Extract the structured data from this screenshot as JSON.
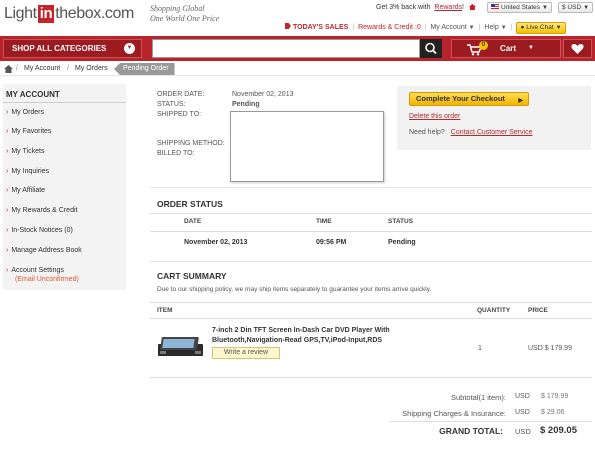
{
  "header": {
    "logo_left": "Light",
    "logo_in": "in",
    "logo_right": "thebox.com",
    "tagline_1": "Shopping Global",
    "tagline_2": "One World One Price",
    "cashback_text": "Get 3% back with",
    "rewards_link": "Rewards",
    "rewards_suffix": "!",
    "country": "United States",
    "currency": "$ USD",
    "todays_sales": "TODAY'S SALES",
    "rewards_credit": "Rewards & Credit :0",
    "my_account": "My Account",
    "help": "Help",
    "live_chat": "Live Chat"
  },
  "nav": {
    "all_categories": "SHOP ALL CATEGORIES",
    "search_value": "",
    "cart_label": "Cart",
    "cart_count": "0"
  },
  "breadcrumb": {
    "items": [
      "My Account",
      "My Orders"
    ],
    "current": "Pending Order"
  },
  "sidebar": {
    "title": "MY ACCOUNT",
    "items": [
      {
        "label": "My Orders"
      },
      {
        "label": "My Favorites"
      },
      {
        "label": "My Tickets"
      },
      {
        "label": "My Inquiries"
      },
      {
        "label": "My Affiliate"
      },
      {
        "label": "My Rewards & Credit"
      },
      {
        "label": "In-Stock Notices (0)"
      },
      {
        "label": "Manage Address Book"
      },
      {
        "label": "Account Settings"
      }
    ],
    "account_note": "(Email Unconfirmed)"
  },
  "order": {
    "date_label": "ORDER DATE:",
    "date_value": "November 02, 2013",
    "status_label": "STATUS:",
    "status_value": "Pending",
    "shipped_label": "SHIPPED TO:",
    "shipping_method_label": "SHIPPING METHOD:",
    "billed_label": "BILLED TO:",
    "complete_checkout": "Complete Your Checkout",
    "delete_order": "Delete this order",
    "need_help": "Need help?",
    "contact_support": "Contact Customer Service"
  },
  "order_status": {
    "title": "ORDER STATUS",
    "headers": [
      "DATE",
      "TIME",
      "STATUS"
    ],
    "rows": [
      {
        "date": "November 02, 2013",
        "time": "09:56 PM",
        "status": "Pending"
      }
    ]
  },
  "cart_summary": {
    "title": "CART SUMMARY",
    "note": "Due to our shipping policy, we may ship items separately to guarantee your items arrive quickly.",
    "headers": {
      "item": "ITEM",
      "quantity": "QUANTITY",
      "price": "PRICE"
    },
    "items": [
      {
        "name": "7-inch 2 Din TFT Screen In-Dash Car DVD Player With Bluetooth,Navigation-Read GPS,TV,iPod-Input,RDS",
        "quantity": "1",
        "price": "USD $ 179.99",
        "review_button": "Write a review"
      }
    ],
    "subtotal_label": "Subtotal(1 item):",
    "subtotal_currency": "USD",
    "subtotal_value": "$ 179.99",
    "shipping_label": "Shipping Charges & Insurance:",
    "shipping_currency": "USD",
    "shipping_value": "$ 29.06",
    "grand_total_label": "GRAND TOTAL:",
    "grand_total_currency": "USD",
    "grand_total_value": "$ 209.05"
  },
  "colors": {
    "brand_red": "#b8242b",
    "checkout_yellow": "#f0b400",
    "link_red": "#b4282e"
  }
}
